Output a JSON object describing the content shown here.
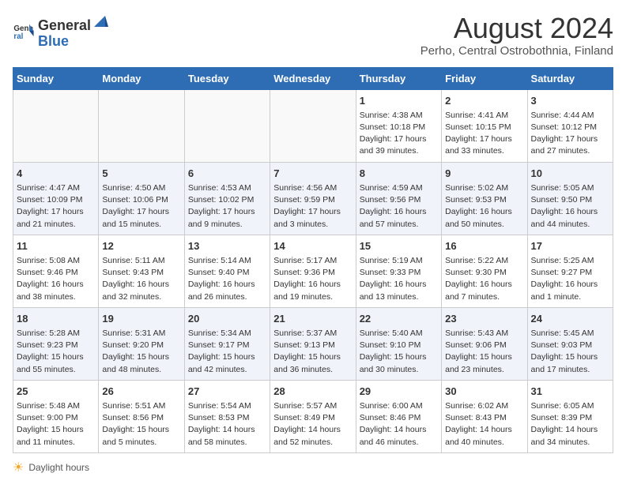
{
  "header": {
    "logo_general": "General",
    "logo_blue": "Blue",
    "title": "August 2024",
    "subtitle": "Perho, Central Ostrobothnia, Finland"
  },
  "columns": [
    "Sunday",
    "Monday",
    "Tuesday",
    "Wednesday",
    "Thursday",
    "Friday",
    "Saturday"
  ],
  "weeks": [
    [
      {
        "day": "",
        "info": ""
      },
      {
        "day": "",
        "info": ""
      },
      {
        "day": "",
        "info": ""
      },
      {
        "day": "",
        "info": ""
      },
      {
        "day": "1",
        "info": "Sunrise: 4:38 AM\nSunset: 10:18 PM\nDaylight: 17 hours\nand 39 minutes."
      },
      {
        "day": "2",
        "info": "Sunrise: 4:41 AM\nSunset: 10:15 PM\nDaylight: 17 hours\nand 33 minutes."
      },
      {
        "day": "3",
        "info": "Sunrise: 4:44 AM\nSunset: 10:12 PM\nDaylight: 17 hours\nand 27 minutes."
      }
    ],
    [
      {
        "day": "4",
        "info": "Sunrise: 4:47 AM\nSunset: 10:09 PM\nDaylight: 17 hours\nand 21 minutes."
      },
      {
        "day": "5",
        "info": "Sunrise: 4:50 AM\nSunset: 10:06 PM\nDaylight: 17 hours\nand 15 minutes."
      },
      {
        "day": "6",
        "info": "Sunrise: 4:53 AM\nSunset: 10:02 PM\nDaylight: 17 hours\nand 9 minutes."
      },
      {
        "day": "7",
        "info": "Sunrise: 4:56 AM\nSunset: 9:59 PM\nDaylight: 17 hours\nand 3 minutes."
      },
      {
        "day": "8",
        "info": "Sunrise: 4:59 AM\nSunset: 9:56 PM\nDaylight: 16 hours\nand 57 minutes."
      },
      {
        "day": "9",
        "info": "Sunrise: 5:02 AM\nSunset: 9:53 PM\nDaylight: 16 hours\nand 50 minutes."
      },
      {
        "day": "10",
        "info": "Sunrise: 5:05 AM\nSunset: 9:50 PM\nDaylight: 16 hours\nand 44 minutes."
      }
    ],
    [
      {
        "day": "11",
        "info": "Sunrise: 5:08 AM\nSunset: 9:46 PM\nDaylight: 16 hours\nand 38 minutes."
      },
      {
        "day": "12",
        "info": "Sunrise: 5:11 AM\nSunset: 9:43 PM\nDaylight: 16 hours\nand 32 minutes."
      },
      {
        "day": "13",
        "info": "Sunrise: 5:14 AM\nSunset: 9:40 PM\nDaylight: 16 hours\nand 26 minutes."
      },
      {
        "day": "14",
        "info": "Sunrise: 5:17 AM\nSunset: 9:36 PM\nDaylight: 16 hours\nand 19 minutes."
      },
      {
        "day": "15",
        "info": "Sunrise: 5:19 AM\nSunset: 9:33 PM\nDaylight: 16 hours\nand 13 minutes."
      },
      {
        "day": "16",
        "info": "Sunrise: 5:22 AM\nSunset: 9:30 PM\nDaylight: 16 hours\nand 7 minutes."
      },
      {
        "day": "17",
        "info": "Sunrise: 5:25 AM\nSunset: 9:27 PM\nDaylight: 16 hours\nand 1 minute."
      }
    ],
    [
      {
        "day": "18",
        "info": "Sunrise: 5:28 AM\nSunset: 9:23 PM\nDaylight: 15 hours\nand 55 minutes."
      },
      {
        "day": "19",
        "info": "Sunrise: 5:31 AM\nSunset: 9:20 PM\nDaylight: 15 hours\nand 48 minutes."
      },
      {
        "day": "20",
        "info": "Sunrise: 5:34 AM\nSunset: 9:17 PM\nDaylight: 15 hours\nand 42 minutes."
      },
      {
        "day": "21",
        "info": "Sunrise: 5:37 AM\nSunset: 9:13 PM\nDaylight: 15 hours\nand 36 minutes."
      },
      {
        "day": "22",
        "info": "Sunrise: 5:40 AM\nSunset: 9:10 PM\nDaylight: 15 hours\nand 30 minutes."
      },
      {
        "day": "23",
        "info": "Sunrise: 5:43 AM\nSunset: 9:06 PM\nDaylight: 15 hours\nand 23 minutes."
      },
      {
        "day": "24",
        "info": "Sunrise: 5:45 AM\nSunset: 9:03 PM\nDaylight: 15 hours\nand 17 minutes."
      }
    ],
    [
      {
        "day": "25",
        "info": "Sunrise: 5:48 AM\nSunset: 9:00 PM\nDaylight: 15 hours\nand 11 minutes."
      },
      {
        "day": "26",
        "info": "Sunrise: 5:51 AM\nSunset: 8:56 PM\nDaylight: 15 hours\nand 5 minutes."
      },
      {
        "day": "27",
        "info": "Sunrise: 5:54 AM\nSunset: 8:53 PM\nDaylight: 14 hours\nand 58 minutes."
      },
      {
        "day": "28",
        "info": "Sunrise: 5:57 AM\nSunset: 8:49 PM\nDaylight: 14 hours\nand 52 minutes."
      },
      {
        "day": "29",
        "info": "Sunrise: 6:00 AM\nSunset: 8:46 PM\nDaylight: 14 hours\nand 46 minutes."
      },
      {
        "day": "30",
        "info": "Sunrise: 6:02 AM\nSunset: 8:43 PM\nDaylight: 14 hours\nand 40 minutes."
      },
      {
        "day": "31",
        "info": "Sunrise: 6:05 AM\nSunset: 8:39 PM\nDaylight: 14 hours\nand 34 minutes."
      }
    ]
  ],
  "footer": {
    "label": "Daylight hours"
  }
}
